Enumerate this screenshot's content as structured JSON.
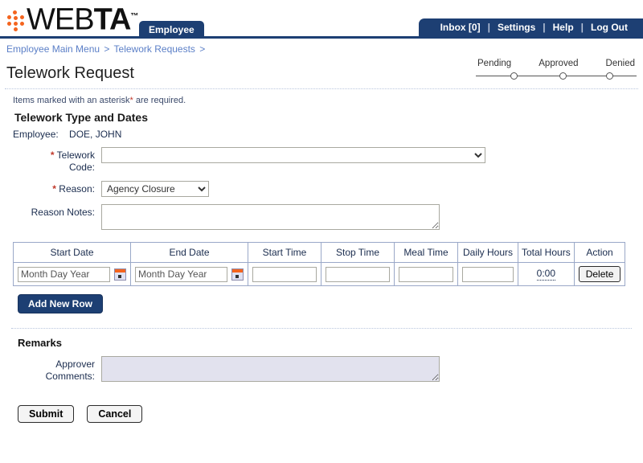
{
  "header": {
    "logo_prefix": "WEB",
    "logo_bold": "TA",
    "logo_tm": "™",
    "role_tab": "Employee",
    "nav": [
      {
        "label": "Inbox [0]",
        "name": "inbox"
      },
      {
        "label": "Settings",
        "name": "settings"
      },
      {
        "label": "Help",
        "name": "help"
      },
      {
        "label": "Log Out",
        "name": "log-out"
      }
    ],
    "nav_separator": "|"
  },
  "breadcrumb": {
    "items": [
      "Employee Main Menu",
      "Telework Requests"
    ],
    "separator": ">",
    "trailing": ">"
  },
  "page": {
    "title": "Telework Request",
    "required_note_before": "Items marked with an asterisk",
    "required_note_asterisk": "*",
    "required_note_after": " are required.",
    "section_heading": "Telework Type and Dates",
    "remarks_heading": "Remarks"
  },
  "tracker": {
    "steps": [
      "Pending",
      "Approved",
      "Denied"
    ]
  },
  "employee": {
    "label": "Employee:",
    "name": "DOE, JOHN"
  },
  "fields": {
    "telework_code": {
      "label_line1": "Telework",
      "label_line2": "Code:",
      "asterisk": "*",
      "value": "",
      "options": [
        ""
      ]
    },
    "reason": {
      "label": "Reason:",
      "asterisk": "*",
      "value": "Agency Closure",
      "options": [
        "Agency Closure"
      ]
    },
    "reason_notes": {
      "label": "Reason Notes:",
      "value": "",
      "placeholder": ""
    },
    "approver_comments": {
      "label_line1": "Approver",
      "label_line2": "Comments:",
      "value": "",
      "placeholder": ""
    }
  },
  "table": {
    "columns": [
      "Start Date",
      "End Date",
      "Start Time",
      "Stop Time",
      "Meal Time",
      "Daily Hours",
      "Total Hours",
      "Action"
    ],
    "rows": [
      {
        "start_date": "Month Day Year",
        "end_date": "Month Day Year",
        "start_time": "",
        "stop_time": "",
        "meal_time": "",
        "daily_hours": "",
        "total_hours": "0:00",
        "action_label": "Delete"
      }
    ]
  },
  "buttons": {
    "add_new_row": "Add New Row",
    "submit": "Submit",
    "cancel": "Cancel"
  },
  "colors": {
    "navy": "#1d3f73",
    "orange": "#f4641e",
    "link_blue": "#5b7fc7",
    "required_red": "#c0392b"
  }
}
